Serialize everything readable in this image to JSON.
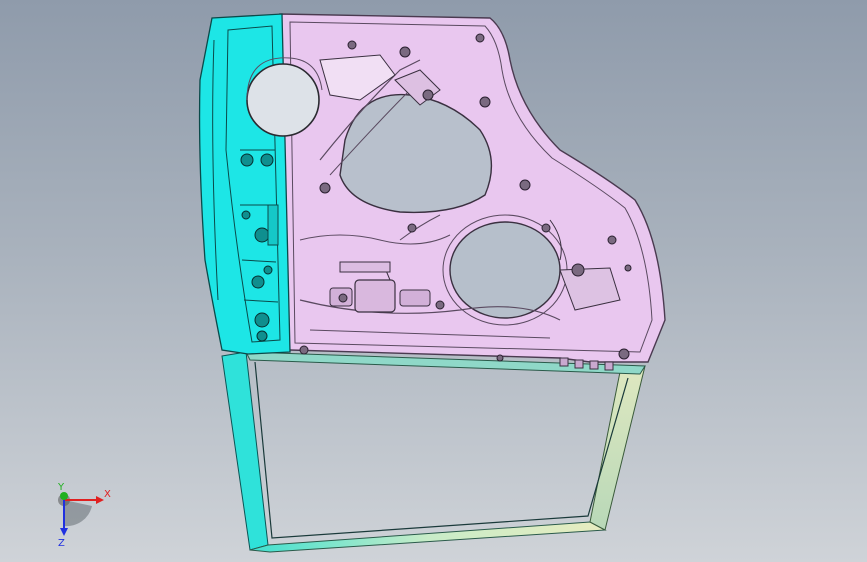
{
  "viewport": {
    "background_top": "#8f9bab",
    "background_bottom": "#cfd3d8"
  },
  "model": {
    "colors": {
      "inner_panel": "#e8c8ee",
      "inner_panel_stroke": "#5a4a60",
      "hinge_reinforcement": "#19e6e6",
      "hinge_stroke": "#0a5a5a",
      "window_frame_front": "#2ee0d8",
      "window_frame_top": "#cfe8c8",
      "window_frame_rear": "#e8ecc8",
      "opening_fill": "#9aa4b0",
      "hardware": "#6a6070"
    }
  },
  "triad": {
    "x_label": "X",
    "y_label": "Y",
    "z_label": "Z",
    "x_color": "#e02020",
    "y_color": "#20b020",
    "z_color": "#2030e0"
  }
}
